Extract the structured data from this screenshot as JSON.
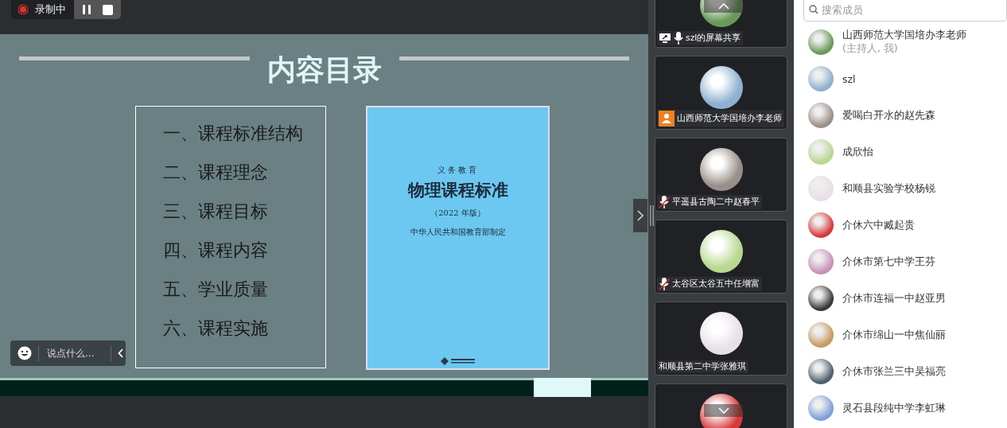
{
  "recording": {
    "label": "录制中"
  },
  "slide": {
    "title": "内容目录",
    "outline": [
      "一、课程标准结构",
      "二、课程理念",
      "三、课程目标",
      "四、课程内容",
      "五、学业质量",
      "六、课程实施"
    ],
    "book": {
      "series": "义务教育",
      "title": "物理课程标准",
      "edition": "（2022 年版）",
      "publisher": "中华人民共和国教育部制定"
    }
  },
  "chat": {
    "placeholder": "说点什么..."
  },
  "gallery": [
    {
      "name": "szl的屏幕共享",
      "screen_sharing": true,
      "mic": true,
      "host": false,
      "muted": false
    },
    {
      "name": "山西师范大学国培办李老师",
      "screen_sharing": false,
      "mic": false,
      "host": true,
      "muted": false
    },
    {
      "name": "平遥县古陶二中赵春平",
      "screen_sharing": false,
      "mic": false,
      "host": false,
      "muted": true
    },
    {
      "name": "太谷区太谷五中任增富",
      "screen_sharing": false,
      "mic": false,
      "host": false,
      "muted": true
    },
    {
      "name": "和顺县第二中学张雅琪",
      "screen_sharing": false,
      "mic": false,
      "host": false,
      "muted": false
    }
  ],
  "members_search": {
    "placeholder": "搜索成员"
  },
  "members": [
    {
      "name": "山西师范大学国培办李老师",
      "role": "(主持人, 我)"
    },
    {
      "name": "szl"
    },
    {
      "name": "爱喝白开水的赵先森"
    },
    {
      "name": "成欣怡"
    },
    {
      "name": "和顺县实验学校杨锐"
    },
    {
      "name": "介休六中臧起贵"
    },
    {
      "name": "介休市第七中学王芬"
    },
    {
      "name": "介休市连福一中赵亚男"
    },
    {
      "name": "介休市绵山一中焦仙丽"
    },
    {
      "name": "介休市张兰三中吴福亮"
    },
    {
      "name": "灵石县段纯中学李虹琳"
    }
  ]
}
